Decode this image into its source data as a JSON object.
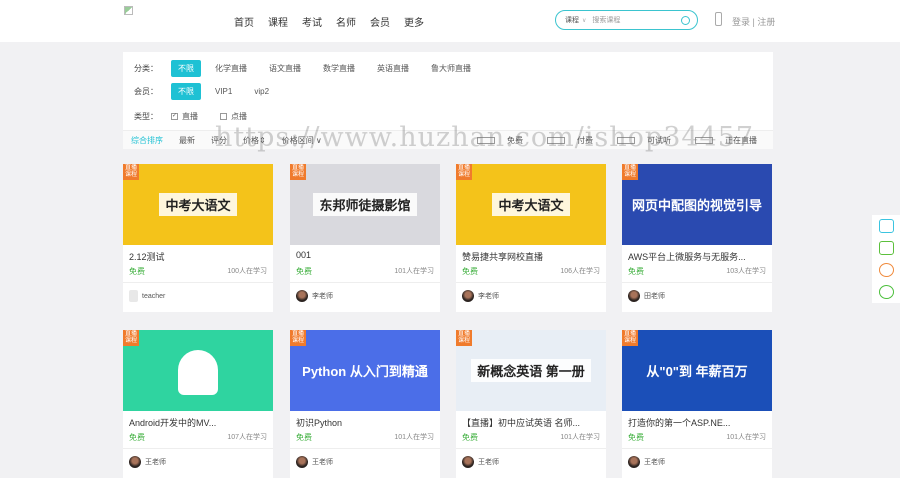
{
  "header": {
    "nav": [
      "首页",
      "课程",
      "考试",
      "名师",
      "会员",
      "更多"
    ],
    "search_category": "课程",
    "search_placeholder": "搜索课程",
    "login": "登录 | 注册"
  },
  "filters": {
    "category_label": "分类：",
    "categories": [
      "不限",
      "化学直播",
      "语文直播",
      "数学直播",
      "英语直播",
      "鲁大师直播"
    ],
    "member_label": "会员：",
    "members": [
      "不限",
      "VIP1",
      "vip2"
    ],
    "type_label": "类型：",
    "types": [
      {
        "label": "直播",
        "checked": true
      },
      {
        "label": "点播",
        "checked": false
      }
    ],
    "sort": [
      "综合排序",
      "最新",
      "评分",
      "价格⇕",
      "价格区间 ∨"
    ],
    "right": [
      {
        "label": "免费",
        "checked": false
      },
      {
        "label": "付费",
        "checked": false
      },
      {
        "label": "可试听",
        "checked": false
      },
      {
        "label": "正在直播",
        "checked": false
      }
    ]
  },
  "watermark": "https://www.huzhan.com/ishop34457",
  "badge": "直播课程",
  "courses": [
    {
      "title": "2.12测试",
      "price": "免费",
      "learners": "100人在学习",
      "teacher": "teacher",
      "image_text": "中考大语文",
      "color": "#f4c31a"
    },
    {
      "title": "001",
      "price": "免费",
      "learners": "101人在学习",
      "teacher": "李老师",
      "image_text": "东邦师徒摄影馆",
      "color": "#d9d9de"
    },
    {
      "title": "赞易捷共享网校直播",
      "price": "免费",
      "learners": "106人在学习",
      "teacher": "李老师",
      "image_text": "中考大语文",
      "color": "#f4c31a"
    },
    {
      "title": "AWS平台上微服务与无服务...",
      "price": "免费",
      "learners": "103人在学习",
      "teacher": "田老师",
      "image_text": "网页中配图的视觉引导",
      "color": "#2a4ab0"
    },
    {
      "title": "Android开发中的MV...",
      "price": "免费",
      "learners": "107人在学习",
      "teacher": "王老师",
      "image_text": "",
      "color": "#2fd4a0"
    },
    {
      "title": "初识Python",
      "price": "免费",
      "learners": "101人在学习",
      "teacher": "王老师",
      "image_text": "Python 从入门到精通",
      "color": "#4b6ee8"
    },
    {
      "title": "【直播】初中应试英语 名师...",
      "price": "免费",
      "learners": "101人在学习",
      "teacher": "王老师",
      "image_text": "新概念英语 第一册",
      "color": "#e8eef5"
    },
    {
      "title": "打造你的第一个ASP.NE...",
      "price": "免费",
      "learners": "101人在学习",
      "teacher": "王老师",
      "image_text": "从\"0\"到 年薪百万",
      "color": "#1b4fb8"
    }
  ],
  "sidebar_icons": [
    "share-icon",
    "message-icon",
    "weibo-icon",
    "wechat-icon"
  ]
}
